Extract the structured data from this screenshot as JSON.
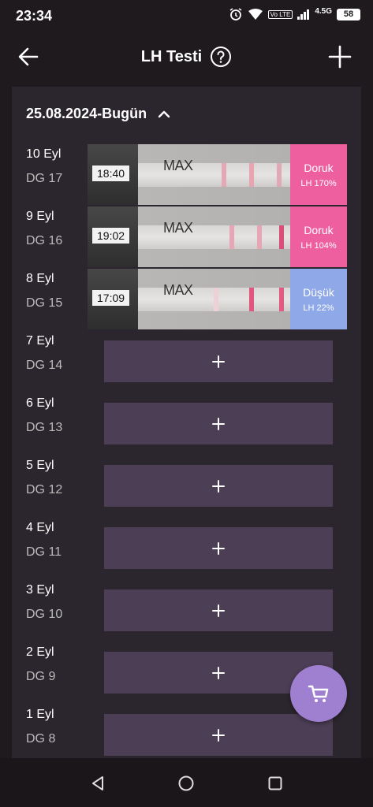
{
  "status": {
    "time": "23:34",
    "network": "4.5G",
    "volte": "Vo LTE",
    "battery": "58"
  },
  "header": {
    "title": "LH Testi"
  },
  "panel": {
    "date_range": "25.08.2024-Bugün"
  },
  "tests": [
    {
      "date": "10 Eyl",
      "dg": "DG 17",
      "time": "18:40",
      "result": "Doruk",
      "lh": "LH 170%",
      "color": "#ee5fa0"
    },
    {
      "date": "9 Eyl",
      "dg": "DG 16",
      "time": "19:02",
      "result": "Doruk",
      "lh": "LH 104%",
      "color": "#ee5fa0"
    },
    {
      "date": "8 Eyl",
      "dg": "DG 15",
      "time": "17:09",
      "result": "Düşük",
      "lh": "LH 22%",
      "color": "#8fa9e8"
    }
  ],
  "strip_text": "MAX",
  "empty_days": [
    {
      "date": "7 Eyl",
      "dg": "DG 14"
    },
    {
      "date": "6 Eyl",
      "dg": "DG 13"
    },
    {
      "date": "5 Eyl",
      "dg": "DG 12"
    },
    {
      "date": "4 Eyl",
      "dg": "DG 11"
    },
    {
      "date": "3 Eyl",
      "dg": "DG 10"
    },
    {
      "date": "2 Eyl",
      "dg": "DG 9"
    },
    {
      "date": "1 Eyl",
      "dg": "DG 8"
    }
  ],
  "colors": {
    "accent": "#9f7fd0",
    "slot": "#4c3e54",
    "high": "#ee5fa0",
    "low": "#8fa9e8"
  },
  "icons": {
    "back": "arrow-left-icon",
    "help": "question-bubble-icon",
    "add": "plus-icon",
    "expand": "chevron-up-icon",
    "cart": "cart-icon",
    "nav_back": "triangle-back-icon",
    "nav_home": "circle-home-icon",
    "nav_recents": "square-recents-icon"
  }
}
